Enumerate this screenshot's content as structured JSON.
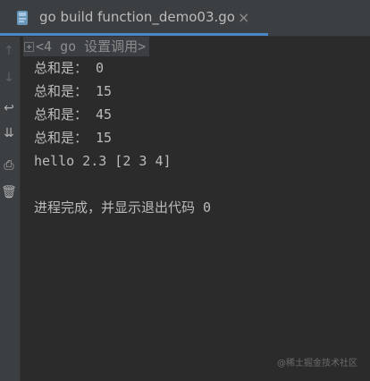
{
  "tab": {
    "title": "go build function_demo03.go",
    "close_glyph": "×",
    "icon": "go-file-icon"
  },
  "gutter": {
    "icons": [
      {
        "name": "rerun-up-icon",
        "glyph": "↑"
      },
      {
        "name": "scroll-down-icon",
        "glyph": "↓"
      },
      {
        "name": "soft-wrap-icon",
        "glyph": "↩"
      },
      {
        "name": "scroll-to-end-icon",
        "glyph": "⇊"
      },
      {
        "name": "print-icon",
        "glyph": "⎙"
      },
      {
        "name": "trash-icon",
        "glyph": "🗑"
      }
    ]
  },
  "console": {
    "header": "<4 go 设置调用>",
    "lines": [
      "总和是： 0",
      "总和是： 15",
      "总和是： 45",
      "总和是： 15",
      "hello 2.3 [2 3 4]",
      "",
      "进程完成，并显示退出代码 0"
    ]
  },
  "watermark": "@稀土掘金技术社区",
  "colors": {
    "background": "#2b2b2b",
    "tabbar": "#3c3f41",
    "accent": "#4a88c7",
    "text": "#bbbbbb"
  }
}
